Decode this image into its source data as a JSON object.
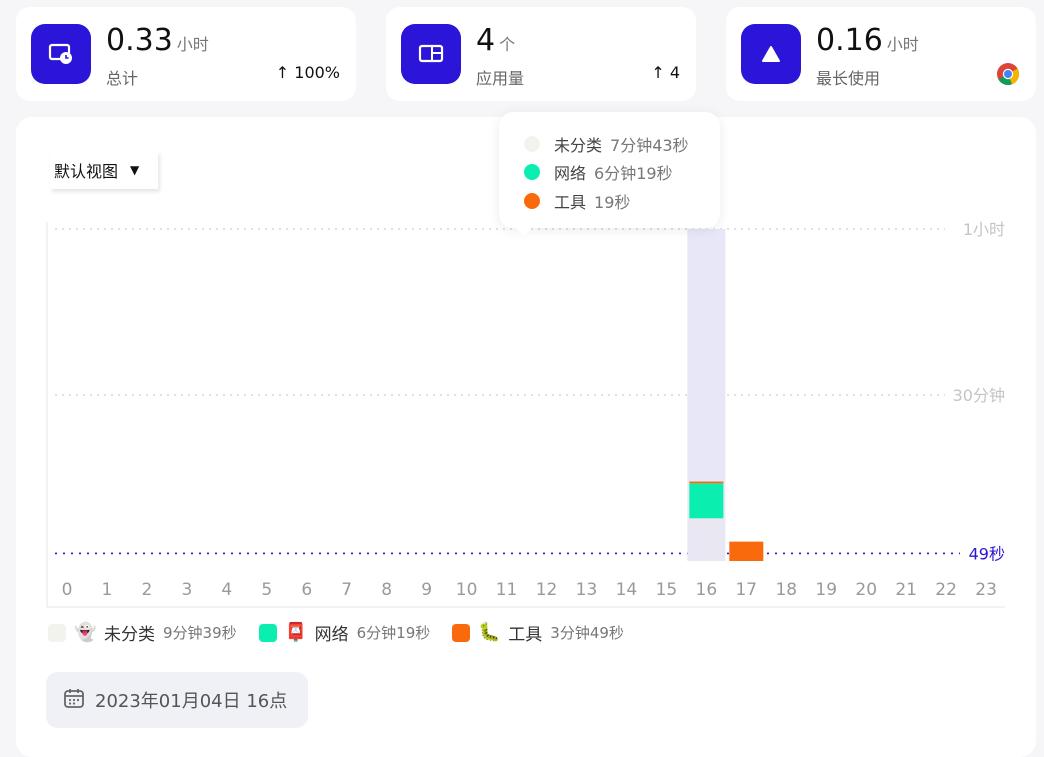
{
  "stats": [
    {
      "value": "0.33",
      "unit": "小时",
      "label": "总计",
      "trend": "↑ 100%",
      "icon": "clock-screen-icon"
    },
    {
      "value": "4",
      "unit": "个",
      "label": "应用量",
      "trend": "↑ 4",
      "icon": "app-window-icon"
    },
    {
      "value": "0.16",
      "unit": "小时",
      "label": "最长使用",
      "trend": "",
      "icon": "triangle-icon",
      "app_icon": "chrome-icon"
    }
  ],
  "view_select": {
    "label": "默认视图",
    "caret": "▼"
  },
  "tooltip": {
    "items": [
      {
        "name": "未分类",
        "value": "7分钟43秒",
        "color": "#f3f3ee"
      },
      {
        "name": "网络",
        "value": "6分钟19秒",
        "color": "#0aeeb0"
      },
      {
        "name": "工具",
        "value": "19秒",
        "color": "#f96a0c"
      }
    ]
  },
  "chart_data": {
    "type": "bar",
    "stacked": true,
    "categories": [
      "0",
      "1",
      "2",
      "3",
      "4",
      "5",
      "6",
      "7",
      "8",
      "9",
      "10",
      "11",
      "12",
      "13",
      "14",
      "15",
      "16",
      "17",
      "18",
      "19",
      "20",
      "21",
      "22",
      "23"
    ],
    "series": [
      {
        "name": "未分类",
        "color": "#e9e8f2",
        "values_minutes": [
          0,
          0,
          0,
          0,
          0,
          0,
          0,
          0,
          0,
          0,
          0,
          0,
          0,
          0,
          0,
          0,
          7.72,
          0,
          0,
          0,
          0,
          0,
          0,
          0
        ]
      },
      {
        "name": "网络",
        "color": "#0aeeb0",
        "values_minutes": [
          0,
          0,
          0,
          0,
          0,
          0,
          0,
          0,
          0,
          0,
          0,
          0,
          0,
          0,
          0,
          0,
          6.32,
          0,
          0,
          0,
          0,
          0,
          0,
          0
        ]
      },
      {
        "name": "工具",
        "color": "#f96a0c",
        "values_minutes": [
          0,
          0,
          0,
          0,
          0,
          0,
          0,
          0,
          0,
          0,
          0,
          0,
          0,
          0,
          0,
          0,
          0.32,
          3.5,
          0,
          0,
          0,
          0,
          0,
          0
        ]
      }
    ],
    "y_ticks": [
      {
        "label": "1小时",
        "minutes": 60
      },
      {
        "label": "30分钟",
        "minutes": 30
      }
    ],
    "average_line": {
      "label": "49秒",
      "minutes": 0.82,
      "color": "#2a15d9"
    },
    "highlight_category": "16",
    "ylim_minutes": [
      0,
      60
    ],
    "grid": true
  },
  "legend": [
    {
      "emoji": "👻",
      "name": "未分类",
      "value": "9分钟39秒",
      "color": "#f3f3ee"
    },
    {
      "emoji": "📮",
      "name": "网络",
      "value": "6分钟19秒",
      "color": "#0aeeb0"
    },
    {
      "emoji": "🐛",
      "name": "工具",
      "value": "3分钟49秒",
      "color": "#f96a0c"
    }
  ],
  "date_picker": {
    "label": "2023年01月04日 16点"
  }
}
